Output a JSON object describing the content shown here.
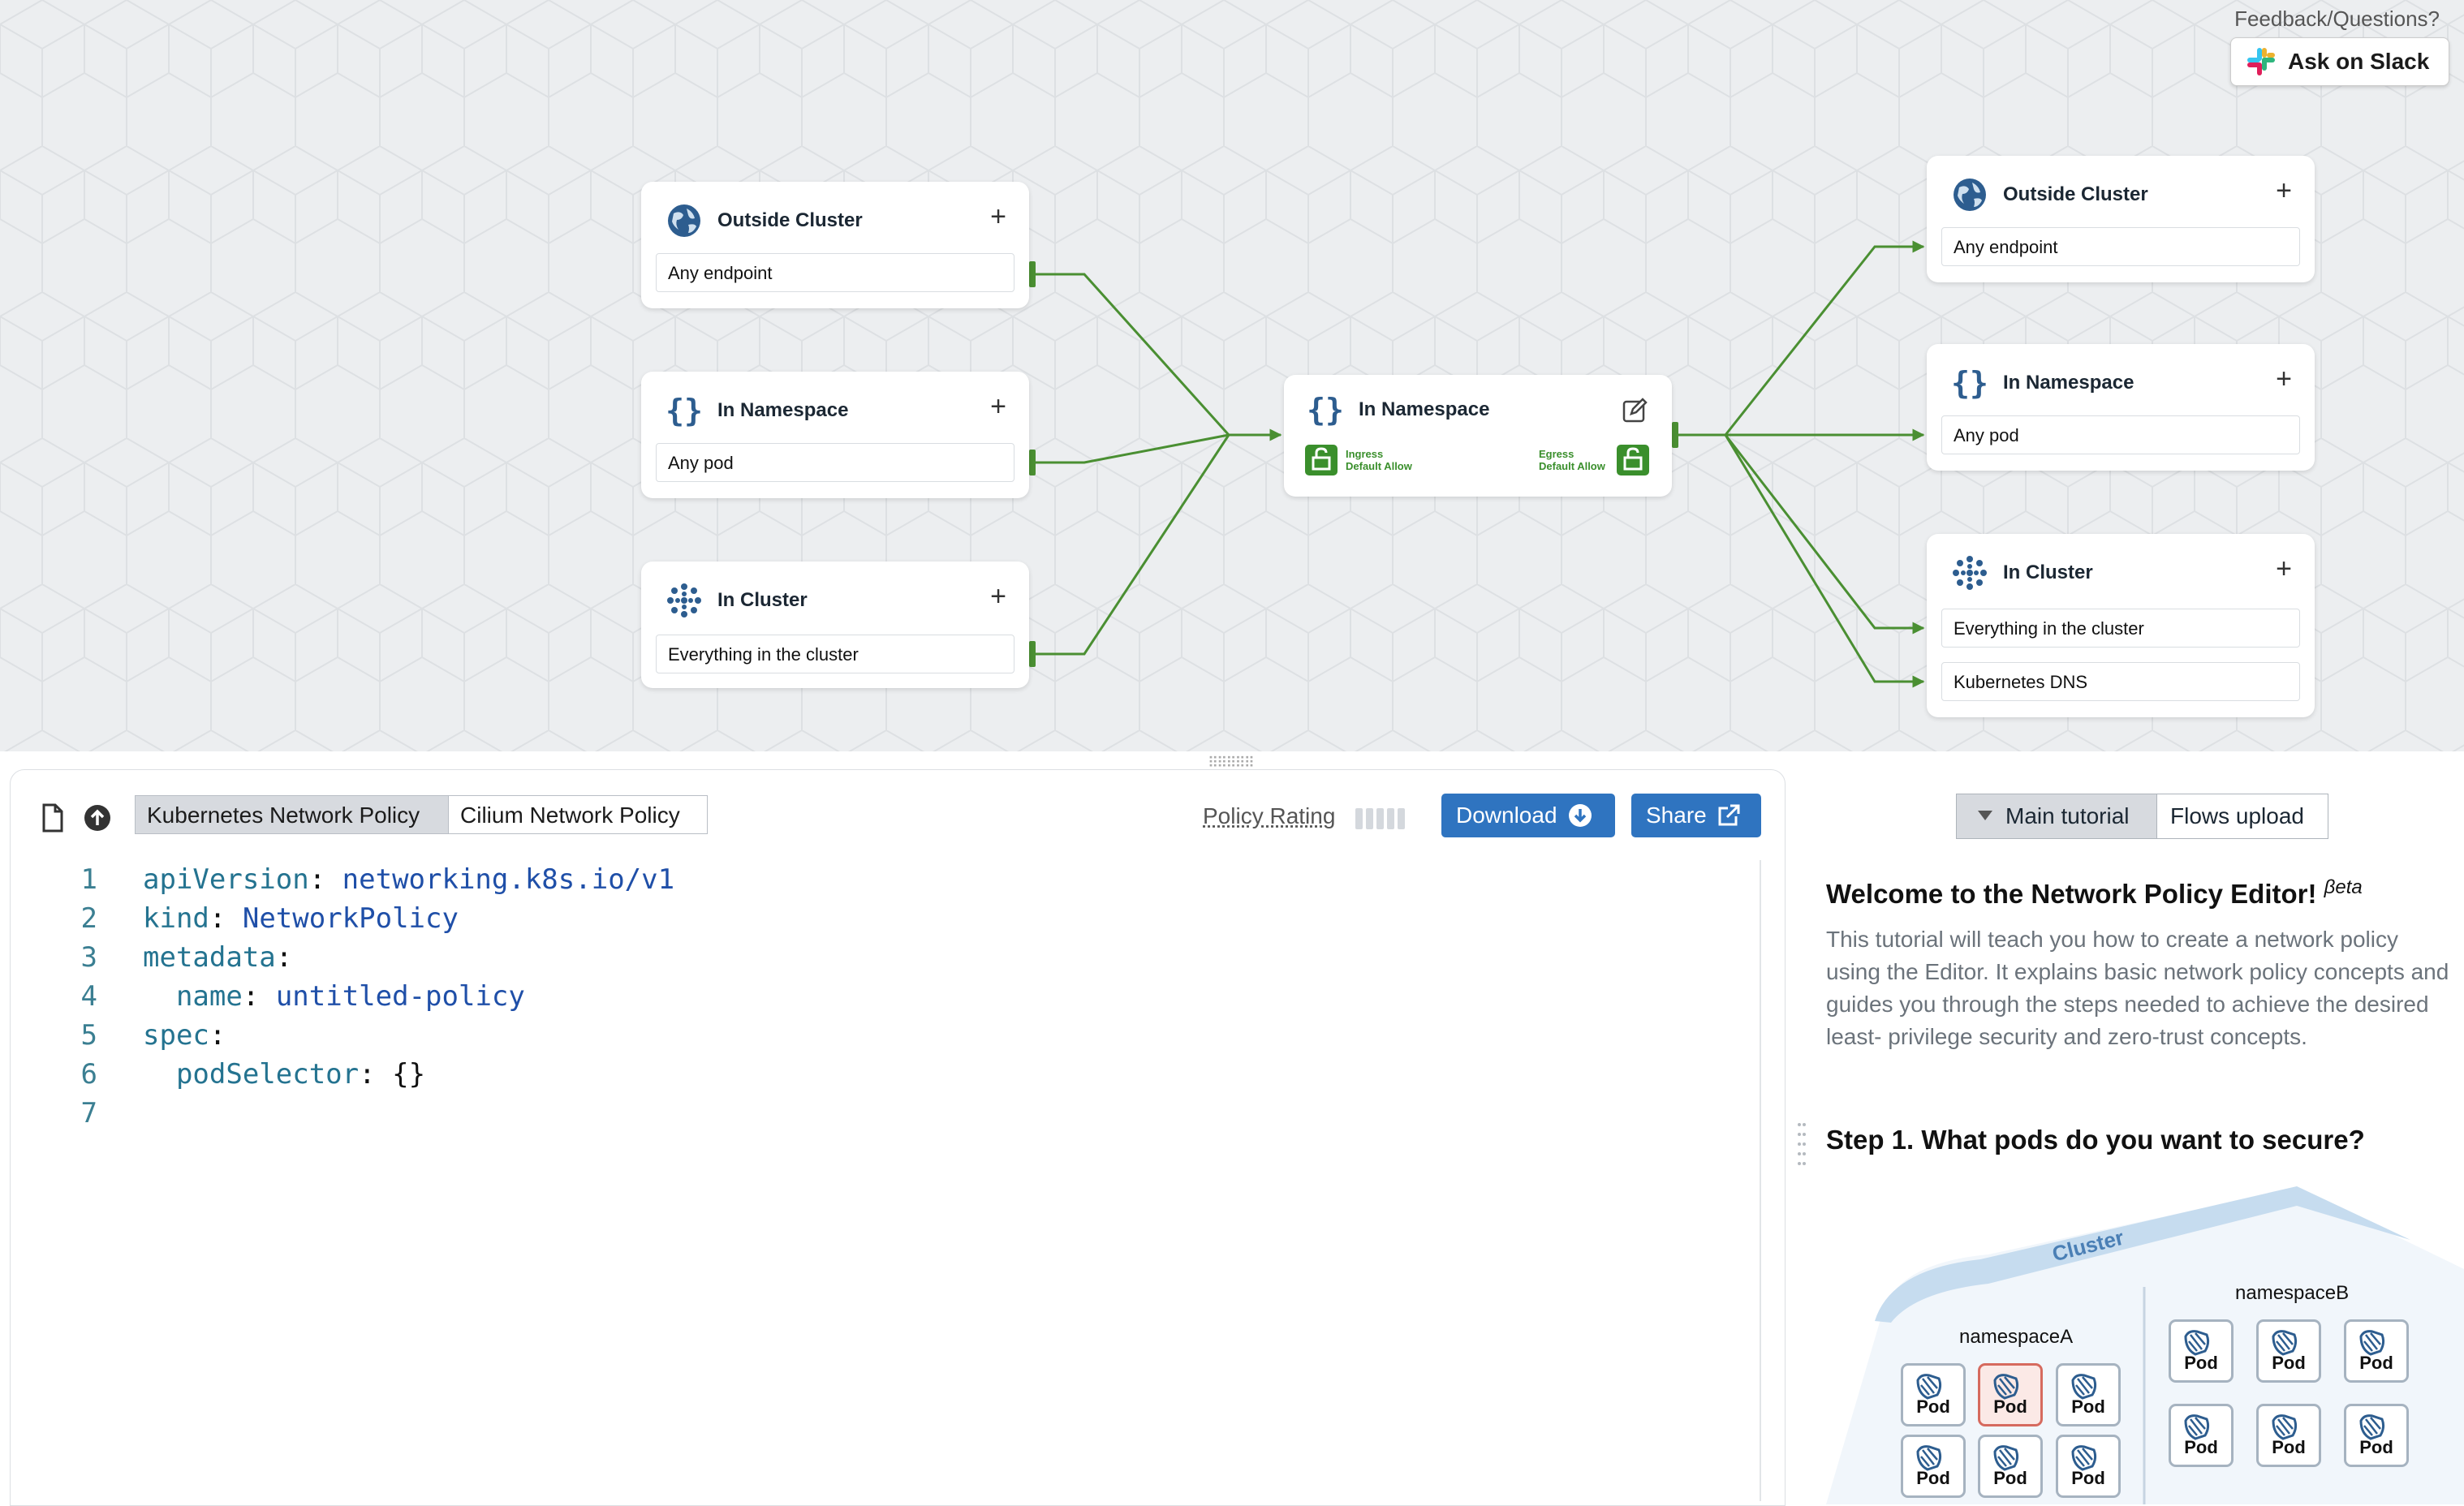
{
  "header": {
    "feedback_text": "Feedback/Questions?",
    "slack_label": "Ask on Slack"
  },
  "graph": {
    "ingress_nodes": [
      {
        "title": "Outside Cluster",
        "icon": "globe-icon",
        "rows": [
          "Any endpoint"
        ]
      },
      {
        "title": "In Namespace",
        "icon": "braces-icon",
        "rows": [
          "Any pod"
        ]
      },
      {
        "title": "In Cluster",
        "icon": "cluster-icon",
        "rows": [
          "Everything in the cluster"
        ]
      }
    ],
    "center": {
      "title": "In Namespace",
      "ingress_label_1": "Ingress",
      "ingress_label_2": "Default Allow",
      "egress_label_1": "Egress",
      "egress_label_2": "Default Allow"
    },
    "egress_nodes": [
      {
        "title": "Outside Cluster",
        "icon": "globe-icon",
        "rows": [
          "Any endpoint"
        ]
      },
      {
        "title": "In Namespace",
        "icon": "braces-icon",
        "rows": [
          "Any pod"
        ]
      },
      {
        "title": "In Cluster",
        "icon": "cluster-icon",
        "rows": [
          "Everything in the cluster",
          "Kubernetes DNS"
        ]
      }
    ],
    "edge_color": "#4a8f32"
  },
  "editor": {
    "tabs": [
      "Kubernetes Network Policy",
      "Cilium Network Policy"
    ],
    "active_tab": 0,
    "policy_rating_label": "Policy Rating",
    "download_label": "Download",
    "share_label": "Share",
    "code_lines": [
      {
        "n": "1",
        "key": "apiVersion",
        "value": "networking.k8s.io/v1",
        "indent": ""
      },
      {
        "n": "2",
        "key": "kind",
        "value": "NetworkPolicy",
        "indent": ""
      },
      {
        "n": "3",
        "key": "metadata",
        "value": "",
        "indent": ""
      },
      {
        "n": "4",
        "key": "name",
        "value": "untitled-policy",
        "indent": "  "
      },
      {
        "n": "5",
        "key": "spec",
        "value": "",
        "indent": ""
      },
      {
        "n": "6",
        "key": "podSelector",
        "value": "{}",
        "indent": "  "
      },
      {
        "n": "7",
        "key": "",
        "value": "",
        "indent": ""
      }
    ]
  },
  "tutorial": {
    "tabs": [
      "Main tutorial",
      "Flows upload"
    ],
    "title": "Welcome to the Network Policy Editor!",
    "title_sup": "βeta",
    "body": "This tutorial will teach you how to create a network policy using the Editor. It explains basic network policy concepts and guides you through the steps needed to achieve the desired least- privilege security and zero-trust concepts.",
    "step": "Step 1. What pods do you want to secure?",
    "diagram": {
      "cluster_label": "Cluster",
      "namespace_a": "namespaceA",
      "namespace_b": "namespaceB",
      "pod_label": "Pod"
    }
  }
}
